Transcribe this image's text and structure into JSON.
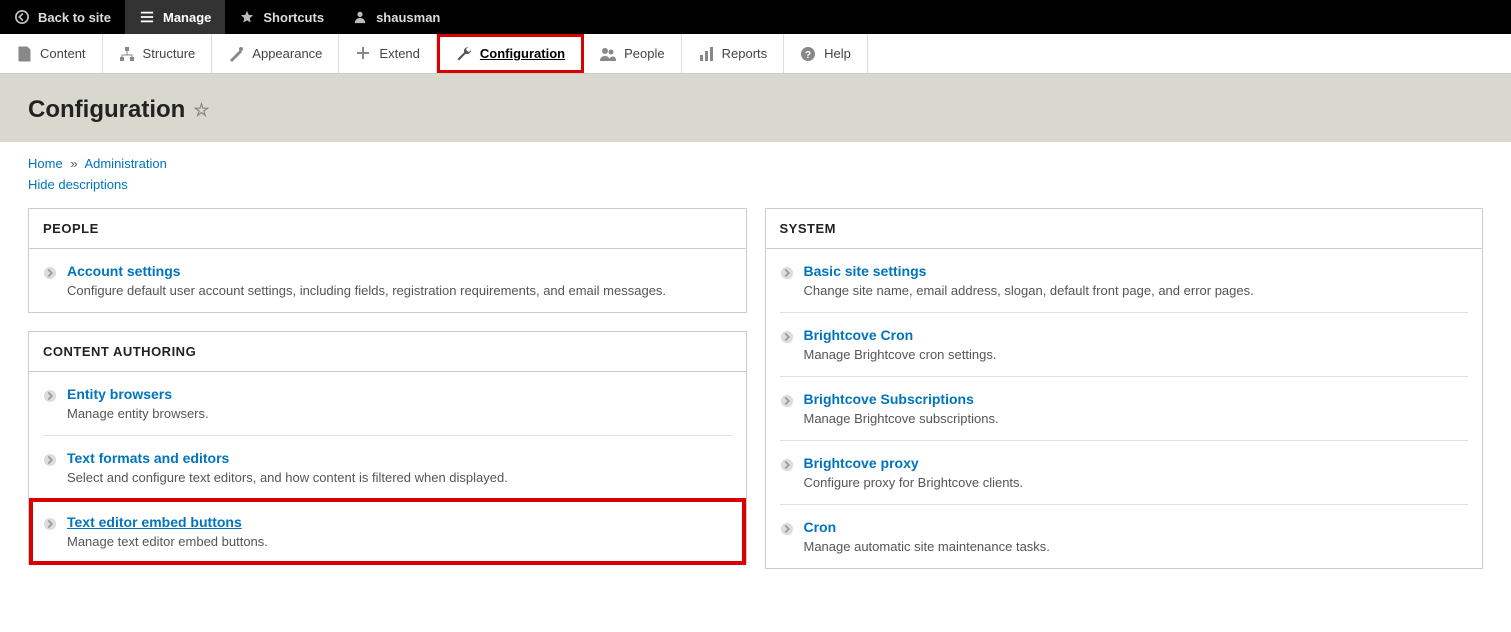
{
  "topbar": {
    "back": "Back to site",
    "manage": "Manage",
    "shortcuts": "Shortcuts",
    "user": "shausman"
  },
  "adminmenu": {
    "items": [
      {
        "label": "Content"
      },
      {
        "label": "Structure"
      },
      {
        "label": "Appearance"
      },
      {
        "label": "Extend"
      },
      {
        "label": "Configuration"
      },
      {
        "label": "People"
      },
      {
        "label": "Reports"
      },
      {
        "label": "Help"
      }
    ]
  },
  "page": {
    "title": "Configuration",
    "breadcrumb": {
      "home": "Home",
      "admin": "Administration"
    },
    "hide_desc": "Hide descriptions"
  },
  "left": [
    {
      "heading": "PEOPLE",
      "entries": [
        {
          "title": "Account settings",
          "desc": "Configure default user account settings, including fields, registration requirements, and email messages."
        }
      ]
    },
    {
      "heading": "CONTENT AUTHORING",
      "entries": [
        {
          "title": "Entity browsers",
          "desc": "Manage entity browsers."
        },
        {
          "title": "Text formats and editors",
          "desc": "Select and configure text editors, and how content is filtered when displayed."
        },
        {
          "title": "Text editor embed buttons",
          "desc": "Manage text editor embed buttons.",
          "hl": true
        }
      ]
    }
  ],
  "right": [
    {
      "heading": "SYSTEM",
      "entries": [
        {
          "title": "Basic site settings",
          "desc": "Change site name, email address, slogan, default front page, and error pages."
        },
        {
          "title": "Brightcove Cron",
          "desc": "Manage Brightcove cron settings."
        },
        {
          "title": "Brightcove Subscriptions",
          "desc": "Manage Brightcove subscriptions."
        },
        {
          "title": "Brightcove proxy",
          "desc": "Configure proxy for Brightcove clients."
        },
        {
          "title": "Cron",
          "desc": "Manage automatic site maintenance tasks."
        }
      ]
    }
  ]
}
